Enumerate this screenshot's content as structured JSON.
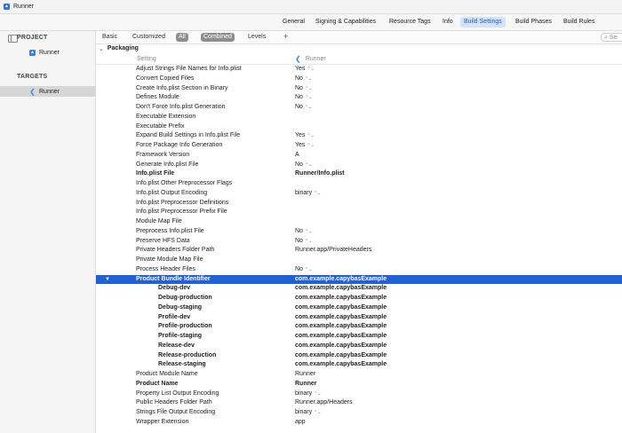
{
  "window": {
    "title": "Runner"
  },
  "editor_tabs": [
    {
      "label": "General",
      "active": false
    },
    {
      "label": "Signing & Capabilities",
      "active": false
    },
    {
      "label": "Resource Tags",
      "active": false
    },
    {
      "label": "Info",
      "active": false
    },
    {
      "label": "Build Settings",
      "active": true
    },
    {
      "label": "Build Phases",
      "active": false
    },
    {
      "label": "Build Rules",
      "active": false
    }
  ],
  "sidebar": {
    "project_header": "PROJECT",
    "project_item": "Runner",
    "targets_header": "TARGETS",
    "target_item": "Runner"
  },
  "filterbar": {
    "basic": "Basic",
    "customized": "Customized",
    "all": "All",
    "combined": "Combined",
    "levels": "Levels",
    "plus": "+",
    "search_placeholder": "Se"
  },
  "group": {
    "name": "Packaging"
  },
  "columns": {
    "setting": "Setting",
    "target": "Runner"
  },
  "rows": [
    {
      "setting": "Adjust Strings File Names for Info.plist",
      "value": "Yes"
    },
    {
      "setting": "Convert Copied Files",
      "value": "No"
    },
    {
      "setting": "Create Info.plist Section in Binary",
      "value": "No"
    },
    {
      "setting": "Defines Module",
      "value": "No"
    },
    {
      "setting": "Don't Force Info.plist Generation",
      "value": "No"
    },
    {
      "setting": "Executable Extension",
      "value": ""
    },
    {
      "setting": "Executable Prefix",
      "value": ""
    },
    {
      "setting": "Expand Build Settings in Info.plist File",
      "value": "Yes"
    },
    {
      "setting": "Force Package Info Generation",
      "value": "Yes"
    },
    {
      "setting": "Framework Version",
      "value": "A"
    },
    {
      "setting": "Generate Info.plist File",
      "value": "No"
    },
    {
      "setting": "Info.plist File",
      "value": "Runner/Info.plist"
    },
    {
      "setting": "Info.plist Other Preprocessor Flags",
      "value": ""
    },
    {
      "setting": "Info.plist Output Encoding",
      "value": "binary"
    },
    {
      "setting": "Info.plist Preprocessor Definitions",
      "value": ""
    },
    {
      "setting": "Info.plist Preprocessor Prefix File",
      "value": ""
    },
    {
      "setting": "Module Map File",
      "value": ""
    },
    {
      "setting": "Preprocess Info.plist File",
      "value": "No"
    },
    {
      "setting": "Preserve HFS Data",
      "value": "No"
    },
    {
      "setting": "Private Headers Folder Path",
      "value": "Runner.app/PrivateHeaders"
    },
    {
      "setting": "Private Module Map File",
      "value": ""
    },
    {
      "setting": "Process Header Files",
      "value": "No"
    },
    {
      "setting": "Product Bundle Identifier",
      "value": "com.example.capybasExample"
    },
    {
      "setting": "Debug-dev",
      "value": "com.example.capybasExample"
    },
    {
      "setting": "Debug-production",
      "value": "com.example.capybasExample"
    },
    {
      "setting": "Debug-staging",
      "value": "com.example.capybasExample"
    },
    {
      "setting": "Profile-dev",
      "value": "com.example.capybasExample"
    },
    {
      "setting": "Profile-production",
      "value": "com.example.capybasExample"
    },
    {
      "setting": "Profile-staging",
      "value": "com.example.capybasExample"
    },
    {
      "setting": "Release-dev",
      "value": "com.example.capybasExample"
    },
    {
      "setting": "Release-production",
      "value": "com.example.capybasExample"
    },
    {
      "setting": "Release-staging",
      "value": "com.example.capybasExample"
    },
    {
      "setting": "Product Module Name",
      "value": "Runner"
    },
    {
      "setting": "Product Name",
      "value": "Runner"
    },
    {
      "setting": "Property List Output Encoding",
      "value": "binary"
    },
    {
      "setting": "Public Headers Folder Path",
      "value": "Runner.app/Headers"
    },
    {
      "setting": "Strings File Output Encoding",
      "value": "binary"
    },
    {
      "setting": "Wrapper Extension",
      "value": "app"
    }
  ]
}
